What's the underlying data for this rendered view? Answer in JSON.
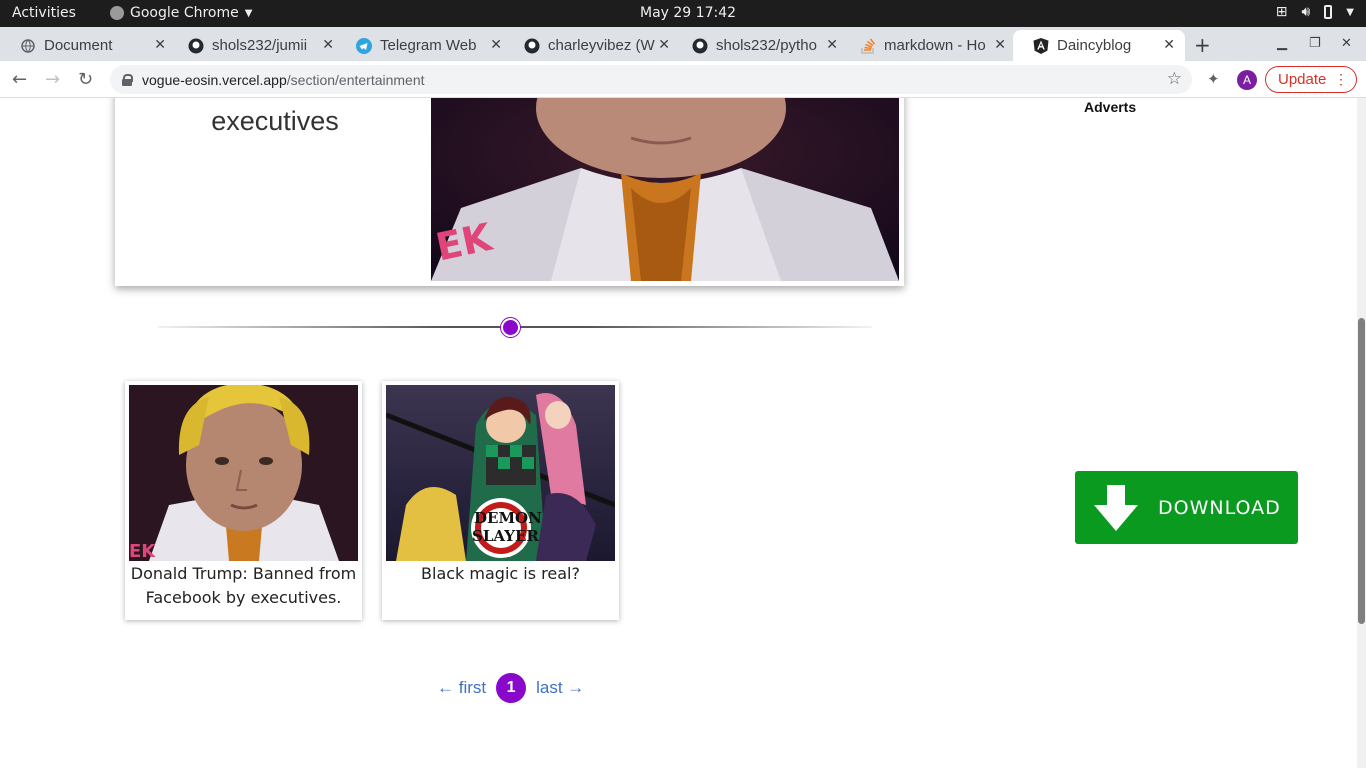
{
  "system": {
    "activities": "Activities",
    "app_name": "Google Chrome",
    "datetime": "May 29  17:42"
  },
  "tabs": [
    {
      "label": "Document",
      "icon": "globe-icon"
    },
    {
      "label": "shols232/jumii",
      "icon": "github-icon"
    },
    {
      "label": "Telegram Web",
      "icon": "telegram-icon"
    },
    {
      "label": "charleyvibez (W",
      "icon": "github-icon"
    },
    {
      "label": "shols232/pytho",
      "icon": "github-icon"
    },
    {
      "label": "markdown - Ho",
      "icon": "stackoverflow-icon"
    },
    {
      "label": "Daincyblog",
      "icon": "angular-icon"
    }
  ],
  "address": {
    "host": "vogue-eosin.vercel.app",
    "path": "/section/entertainment"
  },
  "profile_initial": "A",
  "update_label": "Update",
  "page": {
    "featured_title": "executives",
    "adverts_label": "Adverts",
    "cards": [
      {
        "title": "Donald Trump: Banned from Facebook by executives."
      },
      {
        "title": "Black magic is real?"
      }
    ],
    "download_label": "DOWNLOAD",
    "pager": {
      "first": "← first",
      "current": "1",
      "last": "last →"
    }
  }
}
